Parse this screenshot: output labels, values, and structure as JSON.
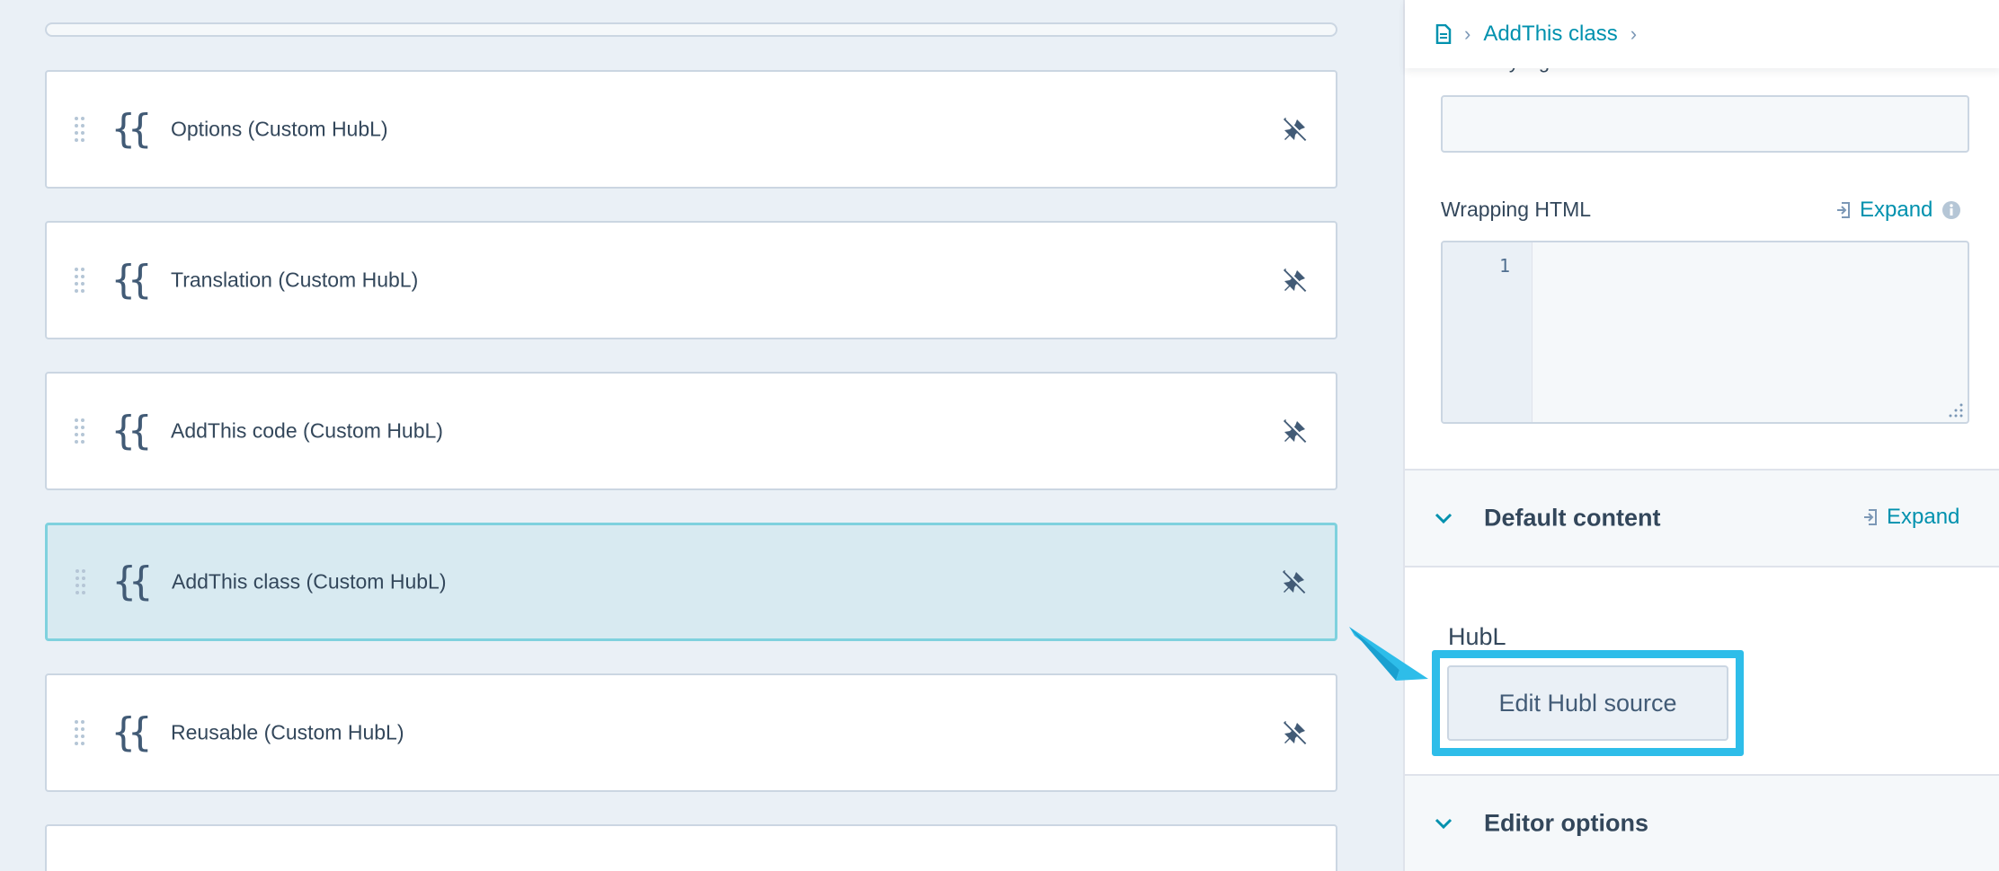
{
  "modules": [
    {
      "label": "Options (Custom HubL)",
      "selected": false
    },
    {
      "label": "Translation (Custom HubL)",
      "selected": false
    },
    {
      "label": "AddThis code (Custom HubL)",
      "selected": false
    },
    {
      "label": "AddThis class (Custom HubL)",
      "selected": true
    },
    {
      "label": "Reusable (Custom HubL)",
      "selected": false
    }
  ],
  "breadcrumb": {
    "current": "AddThis class"
  },
  "inspector": {
    "inline_styling_label": "Inline styling",
    "wrapping_html": {
      "label": "Wrapping HTML",
      "expand_label": "Expand",
      "line_number": "1"
    },
    "default_content": {
      "title": "Default content",
      "expand_label": "Expand",
      "hubl_label": "HubL",
      "edit_button_label": "Edit Hubl source"
    },
    "editor_options": {
      "title": "Editor options"
    }
  },
  "colors": {
    "accent": "#0091ae",
    "highlight": "#2ebde9",
    "selected_bg": "#d8eaf1"
  }
}
